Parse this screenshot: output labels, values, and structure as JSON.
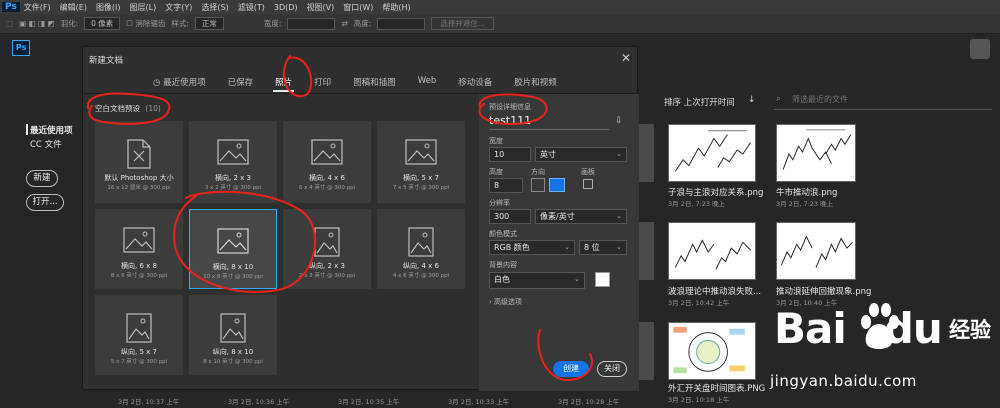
{
  "app": {
    "logo_text": "Ps",
    "menu": [
      "文件(F)",
      "编辑(E)",
      "图像(I)",
      "图层(L)",
      "文字(Y)",
      "选择(S)",
      "滤镜(T)",
      "3D(D)",
      "视图(V)",
      "窗口(W)",
      "帮助(H)"
    ]
  },
  "options_bar": {
    "feather_label": "羽化:",
    "feather_value": "0 像素",
    "antialias_label": "消除锯齿",
    "style_label": "样式:",
    "style_value": "正常",
    "width_label": "宽度:",
    "height_label": "高度:",
    "select_mask_btn": "选择并遮住..."
  },
  "start": {
    "recent_label": "最近使用项",
    "cc_files_label": "CC 文件",
    "new_btn": "新建",
    "open_btn": "打开...",
    "sort_label": "排序 上次打开时间",
    "sort_arrow": "↓",
    "filter_placeholder": "筛选最近的文件",
    "recent_files": [
      {
        "name": "子浪与主浪对应关系.png",
        "date": "3月 2日, 7:23 晚上"
      },
      {
        "name": "牛市推动浪.png",
        "date": "3月 2日, 7:23 晚上"
      },
      {
        "name": "波浪理论中推动浪失败...",
        "date": "3月 2日, 10:42 上午"
      },
      {
        "name": "推动浪延伸回撤现象.png",
        "date": "3月 2日, 10:40 上午"
      },
      {
        "name": "外汇开关盘时间图表.PNG",
        "date": "3月 2日, 10:18 上午"
      }
    ],
    "bottom_dates": [
      "3月 2日, 10:37 上午",
      "3月 2日, 10:36 上午",
      "3月 2日, 10:35 上午",
      "3月 2日, 10:33 上午",
      "3月 2日, 10:28 上午"
    ]
  },
  "dialog": {
    "title": "新建文档",
    "close": "✕",
    "tabs": [
      "最近使用项",
      "已保存",
      "照片",
      "打印",
      "图稿和插图",
      "Web",
      "移动设备",
      "胶片和视频"
    ],
    "active_tab": 2,
    "presets_header": "空白文档预设",
    "presets_count": "(10)",
    "presets": [
      {
        "name": "默认 Photoshop 大小",
        "size": "16 x 12 厘米 @ 300 ppi"
      },
      {
        "name": "横向, 2 x 3",
        "size": "3 x 2 英寸 @ 300 ppi"
      },
      {
        "name": "横向, 4 x 6",
        "size": "6 x 4 英寸 @ 300 ppi"
      },
      {
        "name": "横向, 5 x 7",
        "size": "7 x 5 英寸 @ 300 ppi"
      },
      {
        "name": "横向, 6 x 8",
        "size": "8 x 6 英寸 @ 300 ppi"
      },
      {
        "name": "横向, 8 x 10",
        "size": "10 x 8 英寸 @ 300 ppi"
      },
      {
        "name": "纵向, 2 x 3",
        "size": "2 x 3 英寸 @ 300 ppi"
      },
      {
        "name": "纵向, 4 x 6",
        "size": "4 x 6 英寸 @ 300 ppi"
      },
      {
        "name": "纵向, 5 x 7",
        "size": "5 x 7 英寸 @ 300 ppi"
      },
      {
        "name": "纵向, 8 x 10",
        "size": "8 x 10 英寸 @ 300 ppi"
      }
    ],
    "selected_preset": 5,
    "details": {
      "header": "预设详细信息",
      "doc_name": "test111",
      "width_label": "宽度",
      "width_value": "10",
      "width_unit": "英寸",
      "height_label": "高度",
      "height_value": "8",
      "orientation_label": "方向",
      "artboard_label": "画板",
      "resolution_label": "分辨率",
      "resolution_value": "300",
      "resolution_unit": "像素/英寸",
      "color_mode_label": "颜色模式",
      "color_mode_value": "RGB 颜色",
      "bit_depth": "8 位",
      "bg_label": "背景内容",
      "bg_value": "白色",
      "advanced": "高级选项"
    },
    "create_btn": "创建",
    "close_btn": "关闭"
  },
  "watermark": {
    "bai": "Bai",
    "du": "du",
    "jingyan": "经验",
    "url": "jingyan.baidu.com"
  },
  "colors": {
    "accent": "#1473e6",
    "annotation": "#e8221b",
    "selection_border": "#31a8ff"
  }
}
